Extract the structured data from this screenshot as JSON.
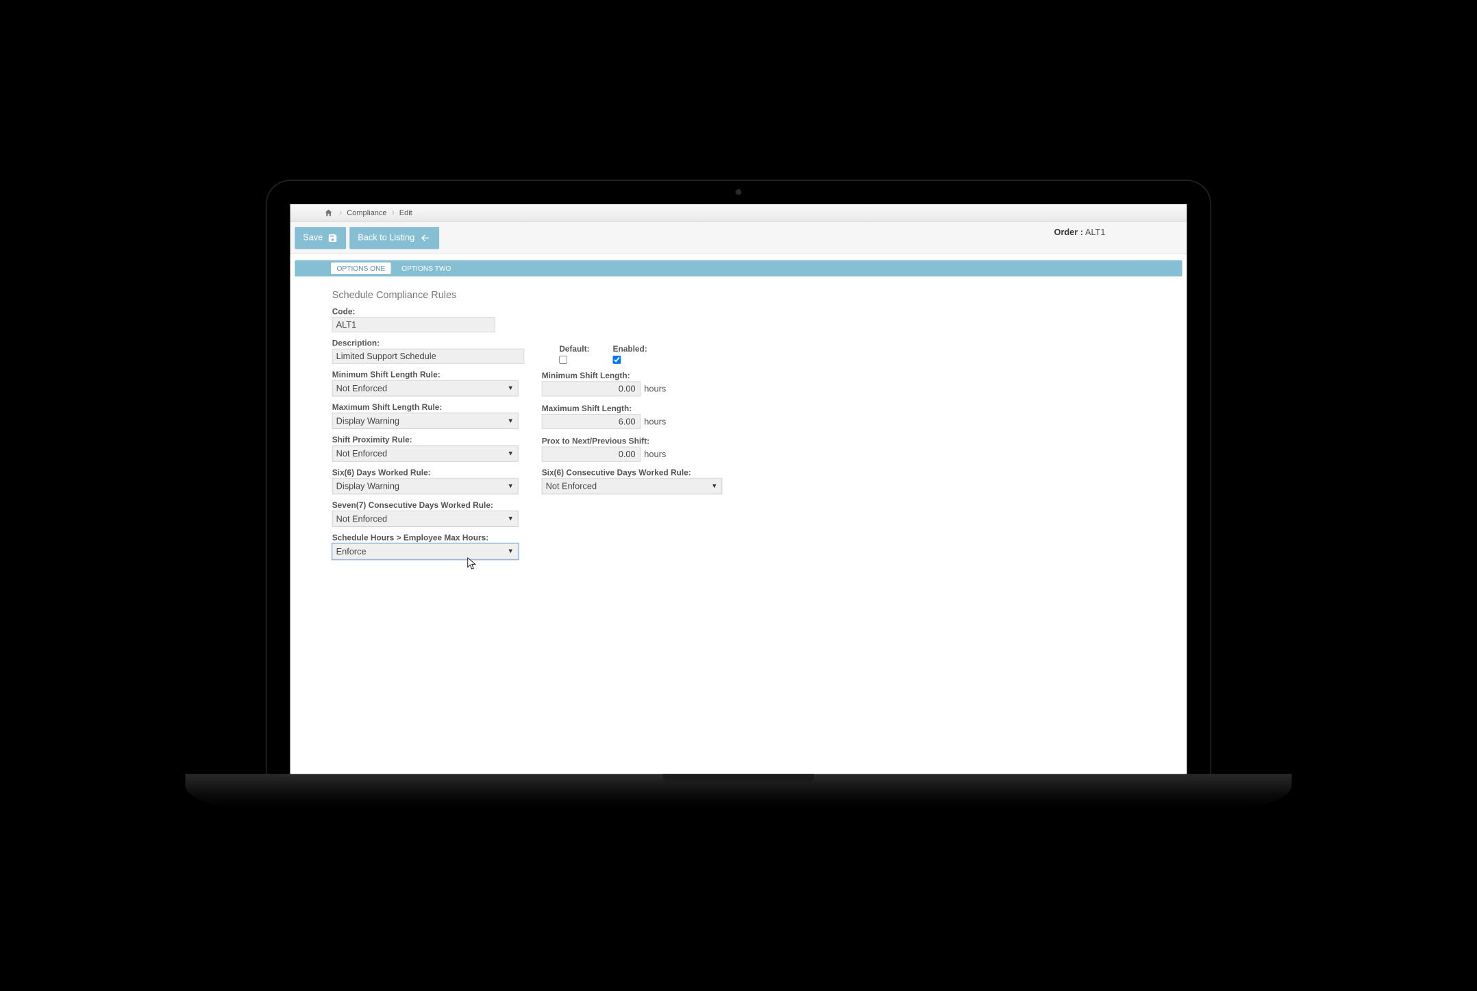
{
  "breadcrumbs": {
    "item1": "Compliance",
    "item2": "Edit"
  },
  "toolbar": {
    "save_label": "Save",
    "back_label": "Back to Listing"
  },
  "order": {
    "label": "Order :",
    "value": "ALT1"
  },
  "tabs": {
    "one": "OPTIONS ONE",
    "two": "OPTIONS TWO"
  },
  "section": {
    "title": "Schedule Compliance Rules"
  },
  "fields": {
    "code_label": "Code:",
    "code_value": "ALT1",
    "desc_label": "Description:",
    "desc_value": "Limited Support Schedule",
    "default_label": "Default:",
    "default_checked": false,
    "enabled_label": "Enabled:",
    "enabled_checked": true,
    "min_rule_label": "Minimum Shift Length Rule:",
    "min_rule_value": "Not Enforced",
    "min_len_label": "Minimum Shift Length:",
    "min_len_value": "0.00",
    "min_len_unit": "hours",
    "max_rule_label": "Maximum Shift Length Rule:",
    "max_rule_value": "Display Warning",
    "max_len_label": "Maximum Shift Length:",
    "max_len_value": "6.00",
    "max_len_unit": "hours",
    "prox_rule_label": "Shift Proximity Rule:",
    "prox_rule_value": "Not Enforced",
    "prox_len_label": "Prox to Next/Previous Shift:",
    "prox_len_value": "0.00",
    "prox_len_unit": "hours",
    "six_rule_label": "Six(6) Days Worked Rule:",
    "six_rule_value": "Display Warning",
    "six_cons_label": "Six(6) Consecutive Days Worked Rule:",
    "six_cons_value": "Not Enforced",
    "seven_cons_label": "Seven(7) Consecutive Days Worked Rule:",
    "seven_cons_value": "Not Enforced",
    "sched_max_label": "Schedule Hours > Employee Max Hours:",
    "sched_max_value": "Enforce"
  },
  "select_options": [
    "Not Enforced",
    "Display Warning",
    "Enforce"
  ]
}
